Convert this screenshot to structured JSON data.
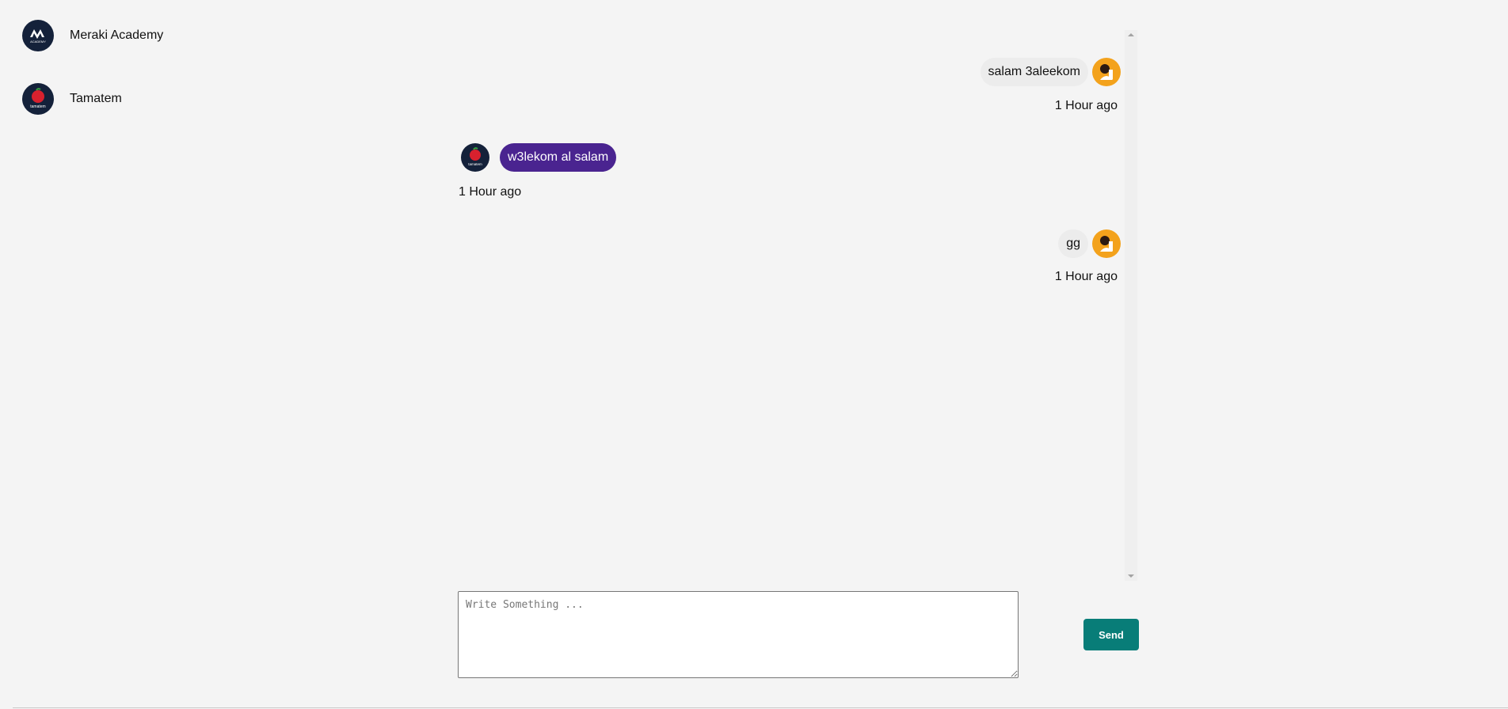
{
  "contacts": [
    {
      "name": "Meraki Academy",
      "avatar_icon": "meraki-academy-logo",
      "avatar_text": "ACADEMY",
      "color": "#14213a"
    },
    {
      "name": "Tamatem",
      "avatar_icon": "tamatem-logo",
      "avatar_text": "tamatem",
      "color": "#14213a"
    }
  ],
  "messages": [
    {
      "text": "salam 3aleekom",
      "time": "1 Hour ago",
      "direction": "sent",
      "avatar_icon": "user-avatar"
    },
    {
      "text": "w3lekom al salam",
      "time": "1 Hour ago",
      "direction": "received",
      "avatar_icon": "tamatem-logo",
      "avatar_text": "tamatem"
    },
    {
      "text": "gg",
      "time": "1 Hour ago",
      "direction": "sent",
      "avatar_icon": "user-avatar"
    }
  ],
  "composer": {
    "placeholder": "Write Something ...",
    "value": "",
    "send_label": "Send"
  },
  "colors": {
    "background": "#f4f4f4",
    "received_bubble": "#4a2490",
    "sent_bubble": "#ececec",
    "send_button": "#087d78",
    "user_avatar": "#f3a21c",
    "logo_dark": "#14213a",
    "tomato_red": "#d8212e"
  }
}
